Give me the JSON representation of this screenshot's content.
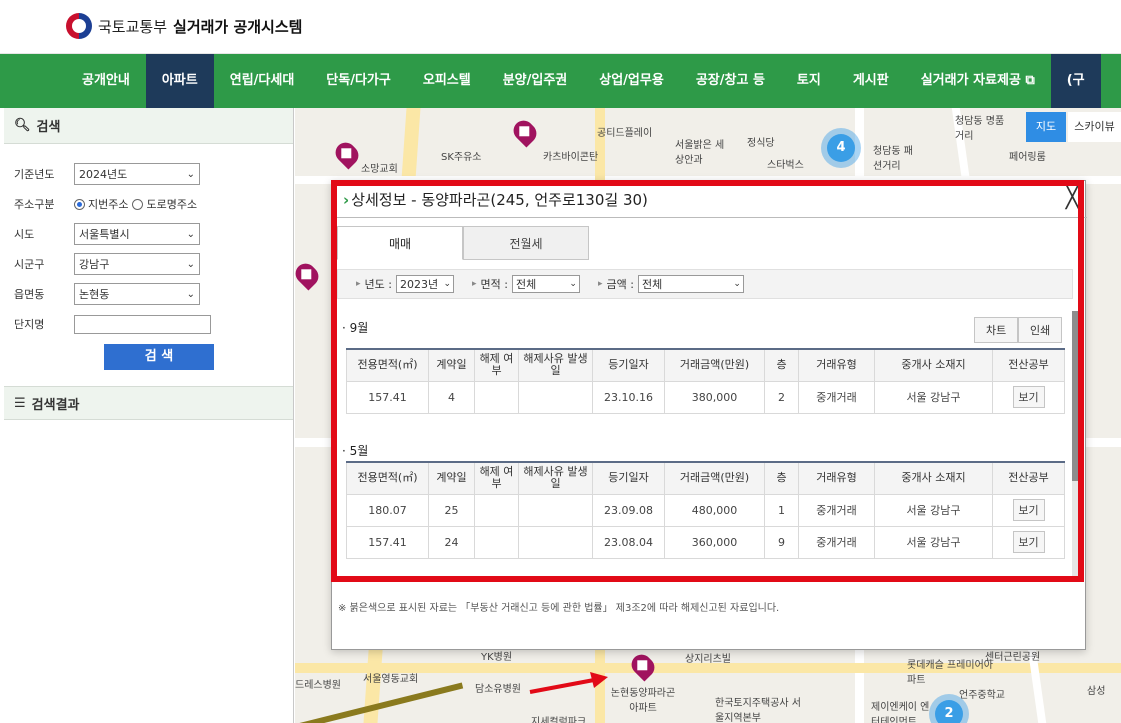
{
  "header": {
    "ministry": "국토교통부",
    "system": "실거래가 공개시스템"
  },
  "nav": {
    "items": [
      "공개안내",
      "아파트",
      "연립/다세대",
      "단독/다가구",
      "오피스텔",
      "분양/입주권",
      "상업/업무용",
      "공장/창고 등",
      "토지",
      "게시판",
      "실거래가 자료제공 ⧉",
      "(구"
    ],
    "active_index": 1
  },
  "search_panel": {
    "title": "검색",
    "fields": {
      "year_label": "기준년도",
      "year_value": "2024년도",
      "addr_label": "주소구분",
      "addr_opt1": "지번주소",
      "addr_opt2": "도로명주소",
      "sido_label": "시도",
      "sido_value": "서울특별시",
      "sigungu_label": "시군구",
      "sigungu_value": "강남구",
      "dong_label": "읍면동",
      "dong_value": "논현동",
      "complex_label": "단지명",
      "complex_value": ""
    },
    "search_button": "검 색",
    "results_title": "검색결과"
  },
  "map": {
    "buttons": {
      "map": "지도",
      "skyview": "스카이뷰"
    },
    "clusters": [
      "4",
      "2"
    ],
    "pois": {
      "cheongdam_sinhwa": "청담동 명품거리",
      "soman": "소망교회",
      "sk": "SK주유소",
      "seoul_balgeun": "서울밝은 세상안과",
      "cheongdam_fashion": "청담동 패션거리",
      "starbucks": "스타벅스",
      "jeongsikdang": "정식당",
      "kakao": "카츠바이콘탄",
      "gongti": "공티드플레이",
      "pink": "페어링룸",
      "seoul_yd": "서울영동교회",
      "damso": "담소유병원",
      "nonhyeon_dongyang": "논현동양파라곤 아파트",
      "korea_housing": "한국토지주택공사 서울지역본부",
      "lotte": "롯데캐슬 프레미어아파트",
      "eonju": "언주중학교",
      "samsung": "삼성",
      "jeil": "제이엔케이 엔터테인먼트",
      "sangji": "상지리츠빌",
      "gyeongchal": "센터근린공원",
      "dress": "드레스병원",
      "yk": "YK병원",
      "jisepark": "지세컬럼파크"
    }
  },
  "modal": {
    "title": "상세정보 - 동양파라곤(245, 언주로130길 30)",
    "close": "╳",
    "tabs": [
      "매매",
      "전월세"
    ],
    "filters": {
      "year_label": "년도 :",
      "year_value": "2023년",
      "area_label": "면적 :",
      "area_value": "전체",
      "price_label": "금액 :",
      "price_value": "전체"
    },
    "chart_button": "차트",
    "print_button": "인쇄",
    "columns": [
      "전용면적(㎡)",
      "계약일",
      "해제 여부",
      "해제사유 발생일",
      "등기일자",
      "거래금액(만원)",
      "층",
      "거래유형",
      "중개사 소재지",
      "전산공부"
    ],
    "groups": [
      {
        "month": "· 9월",
        "rows": [
          [
            "157.41",
            "4",
            "",
            "",
            "23.10.16",
            "380,000",
            "2",
            "중개거래",
            "서울 강남구",
            "보기"
          ]
        ]
      },
      {
        "month": "· 5월",
        "rows": [
          [
            "180.07",
            "25",
            "",
            "",
            "23.09.08",
            "480,000",
            "1",
            "중개거래",
            "서울 강남구",
            "보기"
          ],
          [
            "157.41",
            "24",
            "",
            "",
            "23.08.04",
            "360,000",
            "9",
            "중개거래",
            "서울 강남구",
            "보기"
          ]
        ]
      }
    ],
    "footnote": "※ 붉은색으로 표시된 자료는 「부동산 거래신고 등에 관한 법률」 제3조2에 따라 해제신고된 자료입니다."
  },
  "colors": {
    "nav_green": "#2e9a48",
    "nav_active": "#1e3a5a",
    "highlight_red": "#e20a17",
    "search_blue": "#2f6fd0",
    "pin": "#a0135f"
  }
}
